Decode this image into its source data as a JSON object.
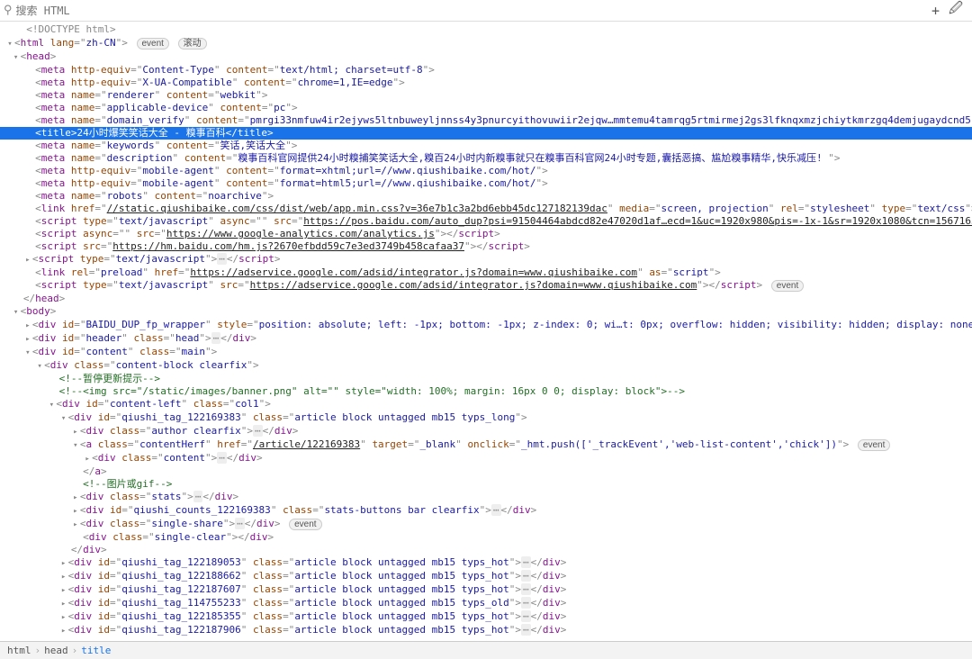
{
  "toolbar": {
    "search_placeholder": "搜索 HTML",
    "plus_icon": "+",
    "wand_icon": "🖉"
  },
  "badges": {
    "event": "event",
    "scroll": "滚动"
  },
  "doctype": "<!DOCTYPE html>",
  "html_lang": "zh-CN",
  "head": {
    "meta_content_type": {
      "http_equiv": "Content-Type",
      "content": "text/html; charset=utf-8"
    },
    "meta_xua": {
      "http_equiv": "X-UA-Compatible",
      "content": "chrome=1,IE=edge"
    },
    "meta_renderer": {
      "name": "renderer",
      "content": "webkit"
    },
    "meta_applicable": {
      "name": "applicable-device",
      "content": "pc"
    },
    "meta_domain_verify": {
      "name": "domain_verify",
      "content": "pmrgi33nmfuw4ir2ejyws5ltnbuweyljnnss4y3pnurcyithovuwiir2ejqw…mmtemu4tamrqg5rtmirmej2gs3lfknqxmzjchiytkmrzgq4demjugaydcnd5"
    },
    "title": "24小时爆笑笑话大全 - 糗事百科",
    "meta_keywords": {
      "name": "keywords",
      "content": "笑话,笑话大全"
    },
    "meta_description": {
      "name": "description",
      "content": "糗事百科官网提供24小时糗捕笑笑话大全,糗百24小时内新糗事就只在糗事百科官网24小时专题,囊括恶搞、尴尬糗事精华,快乐减压! "
    },
    "meta_mobile1": {
      "http_equiv": "mobile-agent",
      "content": "format=xhtml;url=//www.qiushibaike.com/hot/"
    },
    "meta_mobile2": {
      "http_equiv": "mobile-agent",
      "content": "format=html5;url=//www.qiushibaike.com/hot/"
    },
    "meta_robots": {
      "name": "robots",
      "content": "noarchive"
    },
    "link_css": {
      "href": "//static.qiushibaike.com/css/dist/web/app.min.css?v=36e7b1c3a2bd6ebb45dc127182139dac",
      "media": "screen, projection",
      "rel": "stylesheet",
      "type": "text/css"
    },
    "script_pos": {
      "type": "text/javascript",
      "async": "",
      "src": "https://pos.baidu.com/auto_dup?psi=91504464abdcd82e47020d1af…ecd=1&uc=1920x980&pis=-1x-1&sr=1920x1080&tcn=1567165124&dc=4"
    },
    "script_ga": {
      "async": "",
      "src": "https://www.google-analytics.com/analytics.js"
    },
    "script_hm": {
      "src": "https://hm.baidu.com/hm.js?2670efbdd59c7e3ed3749b458cafaa37"
    },
    "script_inline": "text/javascript",
    "link_preload": {
      "rel": "preload",
      "href": "https://adservice.google.com/adsid/integrator.js?domain=www.qiushibaike.com",
      "as": "script"
    },
    "script_adsid": {
      "type": "text/javascript",
      "src": "https://adservice.google.com/adsid/integrator.js?domain=www.qiushibaike.com"
    }
  },
  "body": {
    "baidu_wrapper": {
      "id": "BAIDU_DUP_fp_wrapper",
      "style": "position: absolute; left: -1px; bottom: -1px; z-index: 0; wi…t: 0px; overflow: hidden; visibility: hidden; display: none;"
    },
    "header": {
      "id": "header",
      "class": "head"
    },
    "content": {
      "id": "content",
      "class": "main"
    },
    "content_block_class": "content-block clearfix",
    "comment_pause": "<!--暂停更新提示-->",
    "comment_img": "<!--<img src=\"/static/images/banner.png\" alt=\"\" style=\"width: 100%; margin: 16px 0 0; display: block\">-->",
    "content_left": {
      "id": "content-left",
      "class": "col1"
    },
    "article_main": {
      "id": "qiushi_tag_122169383",
      "class": "article block untagged mb15 typs_long"
    },
    "author_class": "author clearfix",
    "a_content": {
      "class": "contentHerf",
      "href": "/article/122169383",
      "target": "_blank",
      "onclick": "_hmt.push(['_trackEvent','web-list-content','chick'])"
    },
    "content_class": "content",
    "comment_gif": "<!--图片或gif-->",
    "stats_class": "stats",
    "counts": {
      "id": "qiushi_counts_122169383",
      "class": "stats-buttons bar clearfix"
    },
    "single_share": "single-share",
    "single_clear": "single-clear",
    "articles": [
      {
        "id": "qiushi_tag_122189053",
        "class": "article block untagged mb15 typs_hot"
      },
      {
        "id": "qiushi_tag_122188662",
        "class": "article block untagged mb15 typs_hot"
      },
      {
        "id": "qiushi_tag_122187607",
        "class": "article block untagged mb15 typs_hot"
      },
      {
        "id": "qiushi_tag_114755233",
        "class": "article block untagged mb15 typs_old"
      },
      {
        "id": "qiushi_tag_122185355",
        "class": "article block untagged mb15 typs_hot"
      },
      {
        "id": "qiushi_tag_122187906",
        "class": "article block untagged mb15 typs_hot"
      }
    ]
  },
  "breadcrumbs": {
    "c1": "html",
    "c2": "head",
    "c3": "title"
  }
}
